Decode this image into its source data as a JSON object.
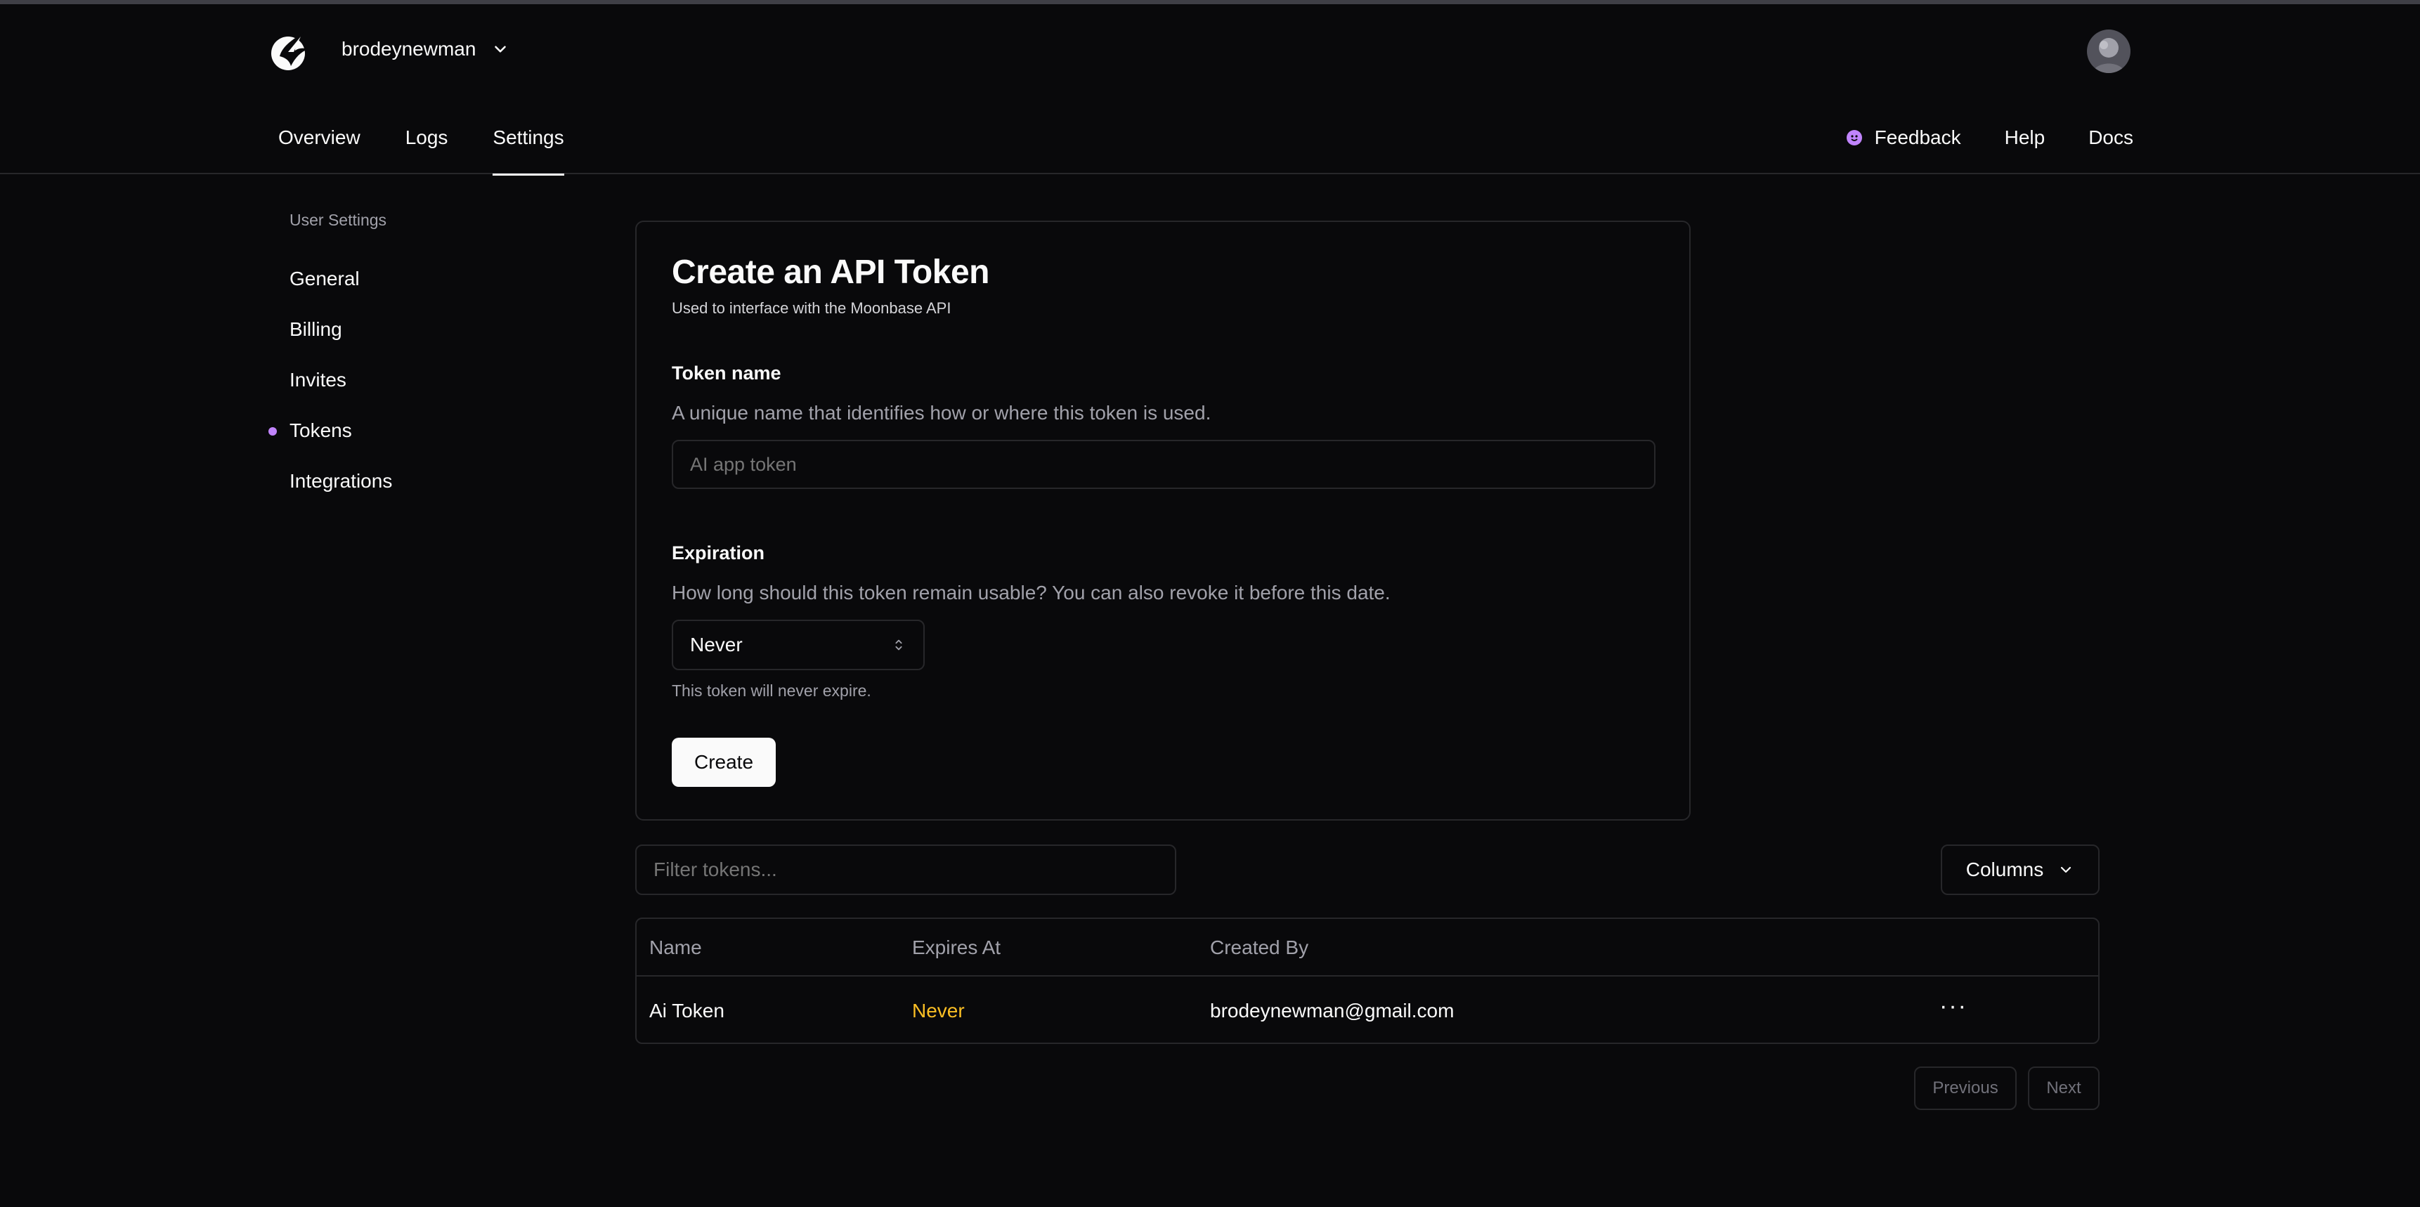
{
  "header": {
    "account_name": "brodeynewman",
    "tabs": [
      {
        "label": "Overview"
      },
      {
        "label": "Logs"
      },
      {
        "label": "Settings",
        "active": true
      }
    ],
    "links": {
      "feedback": "Feedback",
      "help": "Help",
      "docs": "Docs"
    }
  },
  "sidebar": {
    "section": "User Settings",
    "items": [
      {
        "label": "General"
      },
      {
        "label": "Billing"
      },
      {
        "label": "Invites"
      },
      {
        "label": "Tokens",
        "active": true
      },
      {
        "label": "Integrations"
      }
    ]
  },
  "card": {
    "title": "Create an API Token",
    "subtitle": "Used to interface with the Moonbase API",
    "token_name": {
      "label": "Token name",
      "description": "A unique name that identifies how or where this token is used.",
      "placeholder": "AI app token"
    },
    "expiration": {
      "label": "Expiration",
      "description": "How long should this token remain usable? You can also revoke it before this date.",
      "selected": "Never",
      "hint": "This token will never expire."
    },
    "create_label": "Create"
  },
  "tokens": {
    "filter_placeholder": "Filter tokens...",
    "columns_label": "Columns",
    "headers": [
      "Name",
      "Expires At",
      "Created By"
    ],
    "rows": [
      {
        "name": "Ai Token",
        "expires_at": "Never",
        "created_by": "brodeynewman@gmail.com",
        "actions": "···"
      }
    ],
    "pagination": {
      "previous": "Previous",
      "next": "Next"
    }
  },
  "colors": {
    "background": "#09090b",
    "border": "#27272a",
    "accent": "#c084fc",
    "warning": "#fbbf24"
  },
  "icons": {
    "logo": "moonbase-logo-icon",
    "account_dropdown": "chevron-down-icon",
    "feedback": "feedback-dot-icon",
    "select": "chevron-up-down-icon",
    "columns": "chevron-down-icon",
    "row_actions": "more-horizontal-icon"
  }
}
